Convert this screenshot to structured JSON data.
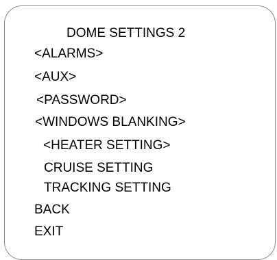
{
  "menu": {
    "title": "DOME SETTINGS 2",
    "items": [
      "<ALARMS>",
      "<AUX>",
      "<PASSWORD>",
      "<WINDOWS BLANKING>",
      "<HEATER SETTING>",
      "CRUISE SETTING",
      "TRACKING SETTING",
      "BACK",
      "EXIT"
    ]
  }
}
